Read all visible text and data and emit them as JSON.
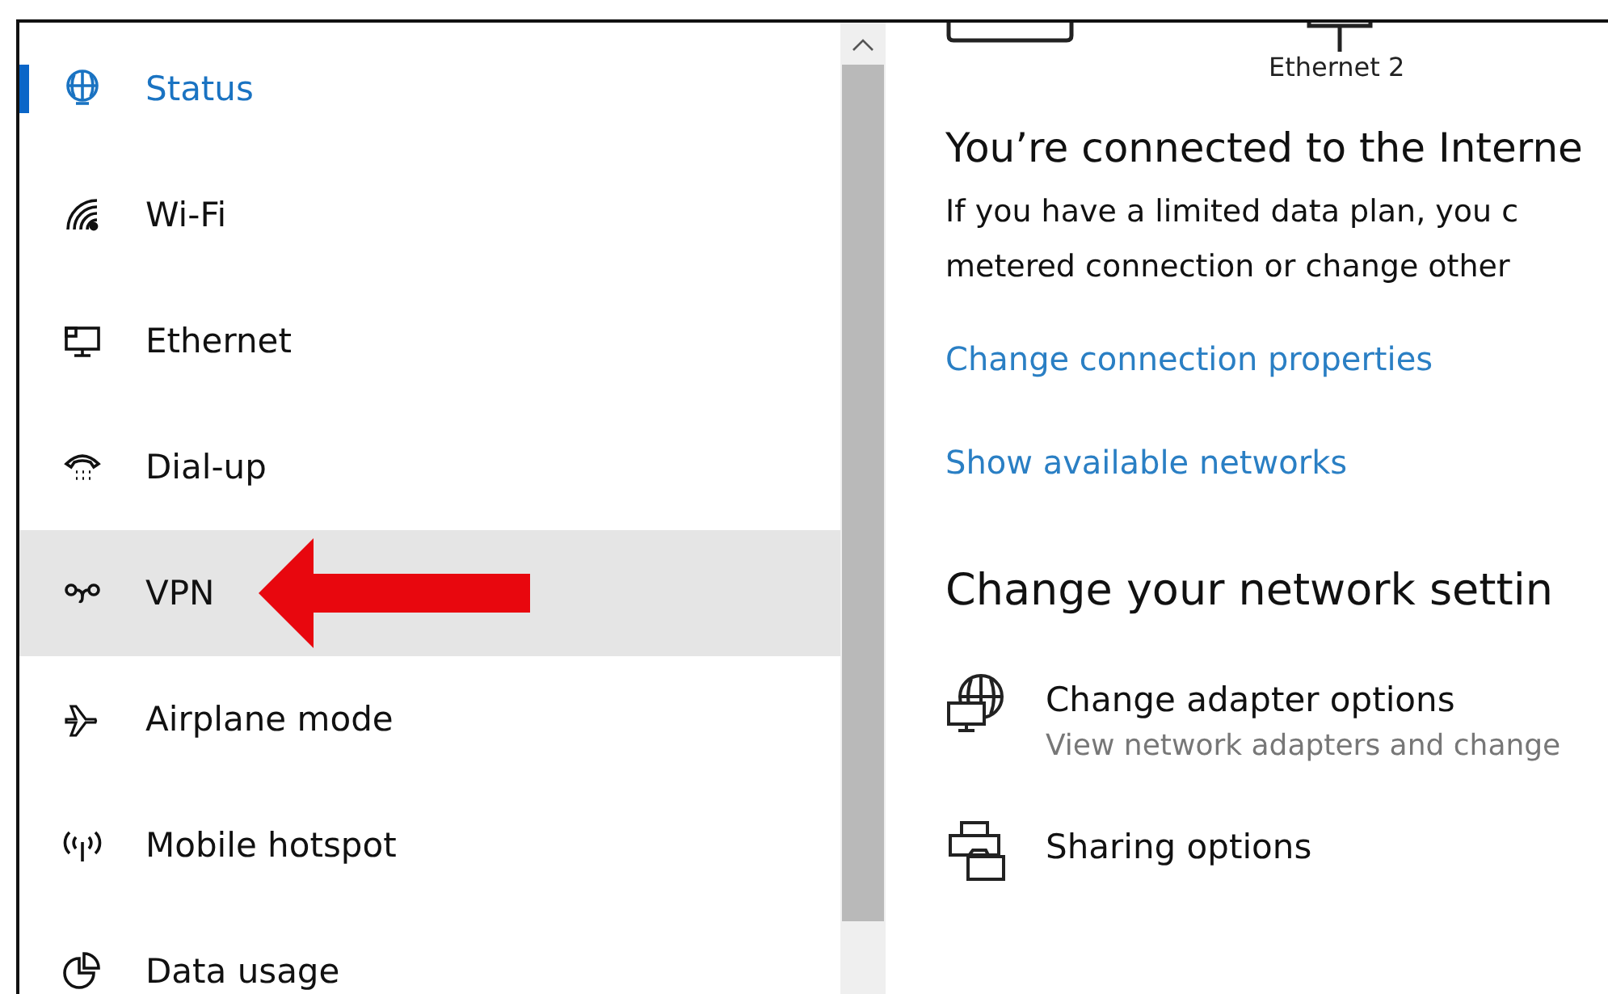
{
  "sidebar": {
    "items": [
      {
        "label": "Status",
        "kind": "status",
        "selected": true,
        "hovered": false
      },
      {
        "label": "Wi-Fi",
        "kind": "wifi",
        "selected": false,
        "hovered": false
      },
      {
        "label": "Ethernet",
        "kind": "ethernet",
        "selected": false,
        "hovered": false
      },
      {
        "label": "Dial-up",
        "kind": "dialup",
        "selected": false,
        "hovered": false
      },
      {
        "label": "VPN",
        "kind": "vpn",
        "selected": false,
        "hovered": true,
        "pointer_arrow": true
      },
      {
        "label": "Airplane mode",
        "kind": "airplane",
        "selected": false,
        "hovered": false
      },
      {
        "label": "Mobile hotspot",
        "kind": "hotspot",
        "selected": false,
        "hovered": false
      },
      {
        "label": "Data usage",
        "kind": "datausage",
        "selected": false,
        "hovered": false
      }
    ]
  },
  "content": {
    "adapter_label": "Ethernet 2",
    "heading": "You’re connected to the Interne",
    "body_lines": [
      "If you have a limited data plan, you c",
      "metered connection or change other"
    ],
    "links": [
      "Change connection properties",
      "Show available networks"
    ],
    "section_title": "Change your network settin",
    "options": [
      {
        "kind": "adapter",
        "title": "Change adapter options",
        "subtitle": "View network adapters and change"
      },
      {
        "kind": "sharing",
        "title": "Sharing options"
      }
    ]
  }
}
